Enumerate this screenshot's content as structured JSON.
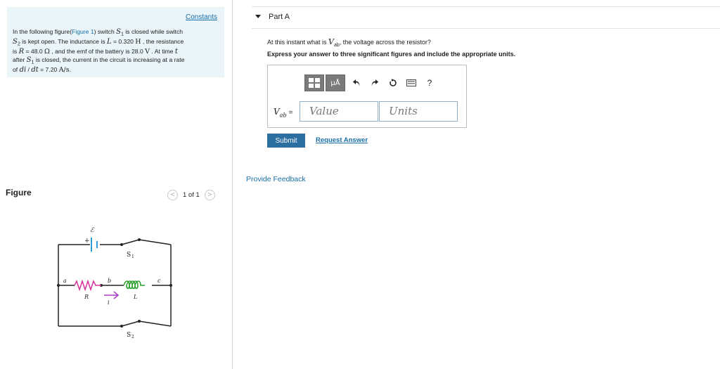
{
  "problem": {
    "constants_link": "Constants",
    "text_intro": "In the following figure(",
    "figure_link": "Figure 1",
    "text_switch": ") switch ",
    "s1": "S",
    "s1_sub": "1",
    "text_closed": " is closed while switch",
    "s2": "S",
    "s2_sub": "2",
    "text_open": " is kept open. The inductance is ",
    "L_sym": "L",
    "L_val": " = 0.320 ",
    "L_unit": "H",
    "text_resist": " , the resistance",
    "text_is": "is ",
    "R_sym": "R",
    "R_val": " = 48.0 ",
    "R_unit": "Ω",
    "text_emf": " , and the emf of the battery is 28.0 ",
    "V_unit": "V",
    "text_time": " . At time ",
    "t_sym": "t",
    "text_after": "after ",
    "s1b": "S",
    "s1b_sub": "1",
    "text_rate": " is closed, the current in the circuit is increasing at a rate",
    "text_of": "of ",
    "di": "di",
    "slash": " / ",
    "dt": "dt",
    "rate_val": " = 7.20 ",
    "rate_unit": "A/s",
    "period": "."
  },
  "figure": {
    "label": "Figure",
    "pager": "1 of 1",
    "prev_glyph": "<",
    "next_glyph": ">",
    "circuit": {
      "emf": "ℰ",
      "plus": "+",
      "s1": "S",
      "s1_sub": "1",
      "s2": "S",
      "s2_sub": "2",
      "a": "a",
      "b": "b",
      "c": "c",
      "R": "R",
      "L": "L",
      "i": "i"
    }
  },
  "part": {
    "title": "Part A",
    "question_pre": "At this instant what is ",
    "q_V": "V",
    "q_sub": "ab",
    "question_post": ", the voltage across the resistor?",
    "instruction": "Express your answer to three significant figures and include the appropriate units.",
    "toolbar": {
      "mu_label": "μÅ",
      "help": "?"
    },
    "answer_label_V": "V",
    "answer_label_sub": "ab",
    "answer_label_eq": "=",
    "value_placeholder": "Value",
    "units_placeholder": "Units",
    "submit": "Submit",
    "request_answer": "Request Answer",
    "feedback": "Provide Feedback"
  },
  "colors": {
    "accent": "#2b6fa0",
    "link": "#1a6fa8",
    "problem_bg": "#eaf5f9",
    "resistor": "#d6339b",
    "inductor": "#2aa12a",
    "battery": "#2a9fd6",
    "current_arrow": "#a83ac6"
  }
}
